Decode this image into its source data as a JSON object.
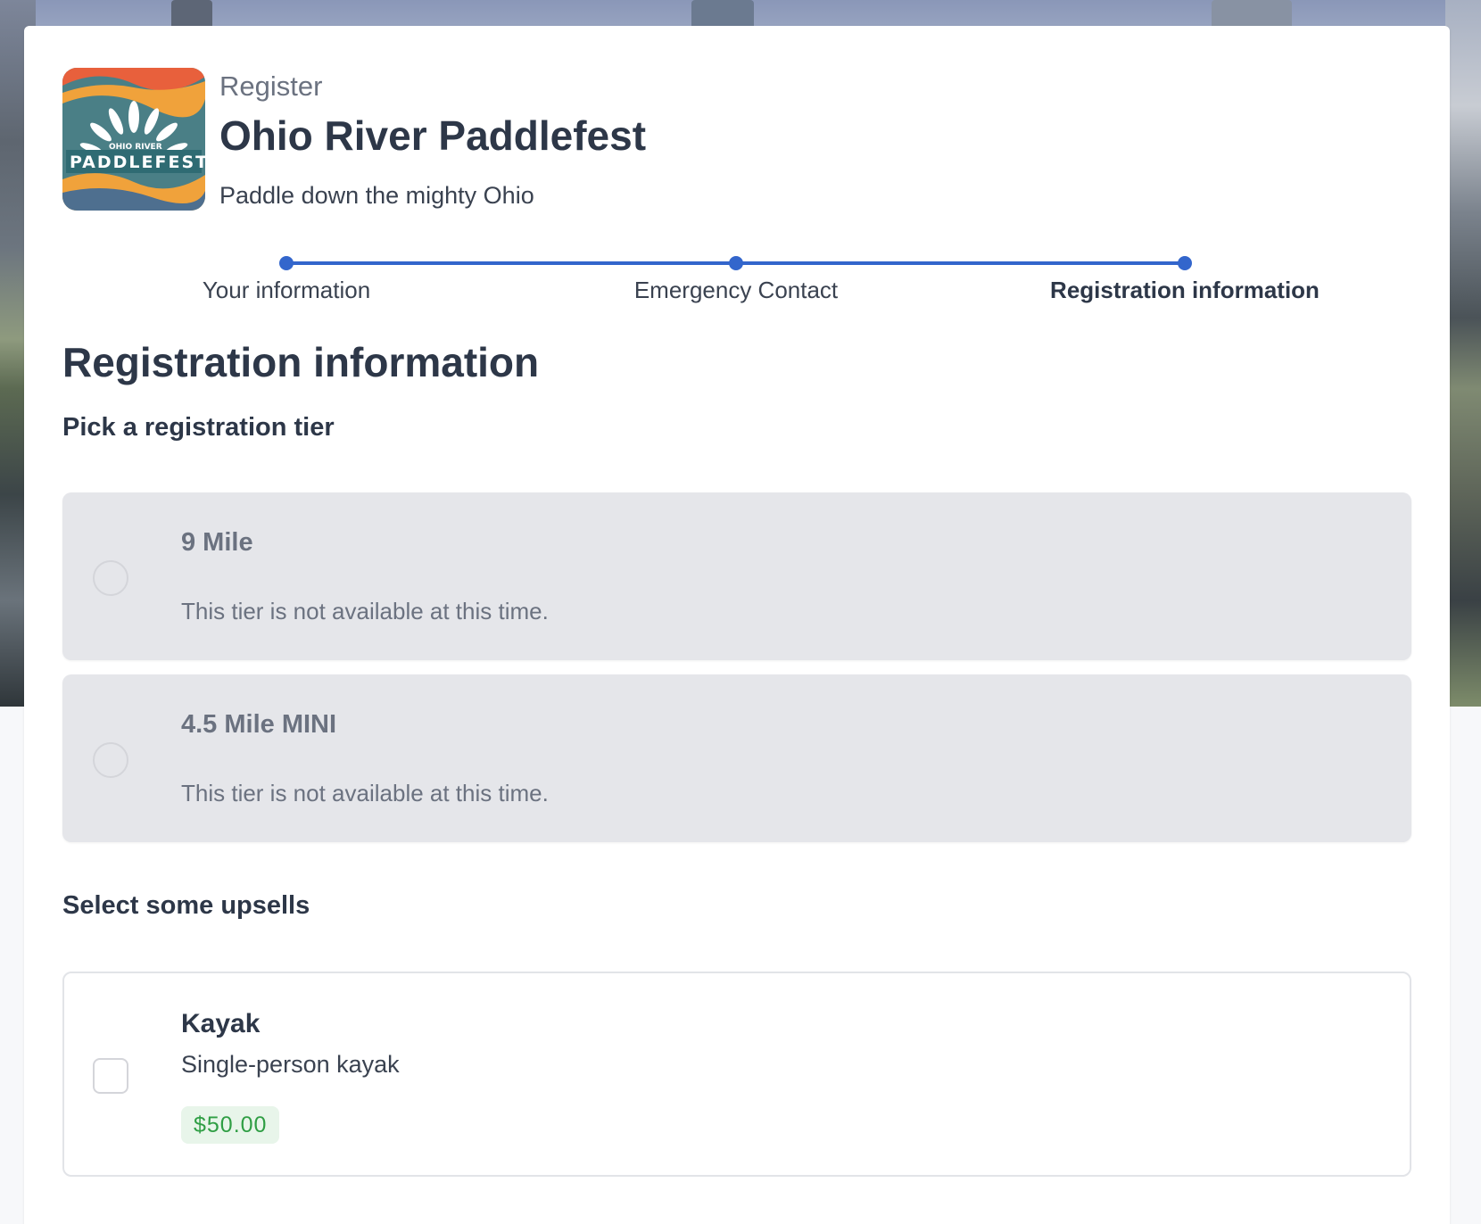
{
  "event": {
    "eyebrow": "Register",
    "title": "Ohio River Paddlefest",
    "tagline": "Paddle down the mighty Ohio",
    "logo_text": "PADDLEFEST",
    "logo_subtext": "OHIO RIVER"
  },
  "stepper": {
    "steps": [
      {
        "label": "Your information",
        "active": false
      },
      {
        "label": "Emergency Contact",
        "active": false
      },
      {
        "label": "Registration information",
        "active": true
      }
    ],
    "accent": "#3366cc"
  },
  "section": {
    "title": "Registration information",
    "tier_heading": "Pick a registration tier",
    "upsell_heading": "Select some upsells"
  },
  "tiers": [
    {
      "name": "9 Mile",
      "message": "This tier is not available at this time.",
      "available": false
    },
    {
      "name": "4.5 Mile MINI",
      "message": "This tier is not available at this time.",
      "available": false
    }
  ],
  "upsells": [
    {
      "name": "Kayak",
      "description": "Single-person kayak",
      "price": "$50.00",
      "checked": false
    }
  ],
  "colors": {
    "price_badge_text": "#2f9e44",
    "price_badge_bg": "#e8f5ea",
    "disabled_card_bg": "#e5e6ea"
  }
}
